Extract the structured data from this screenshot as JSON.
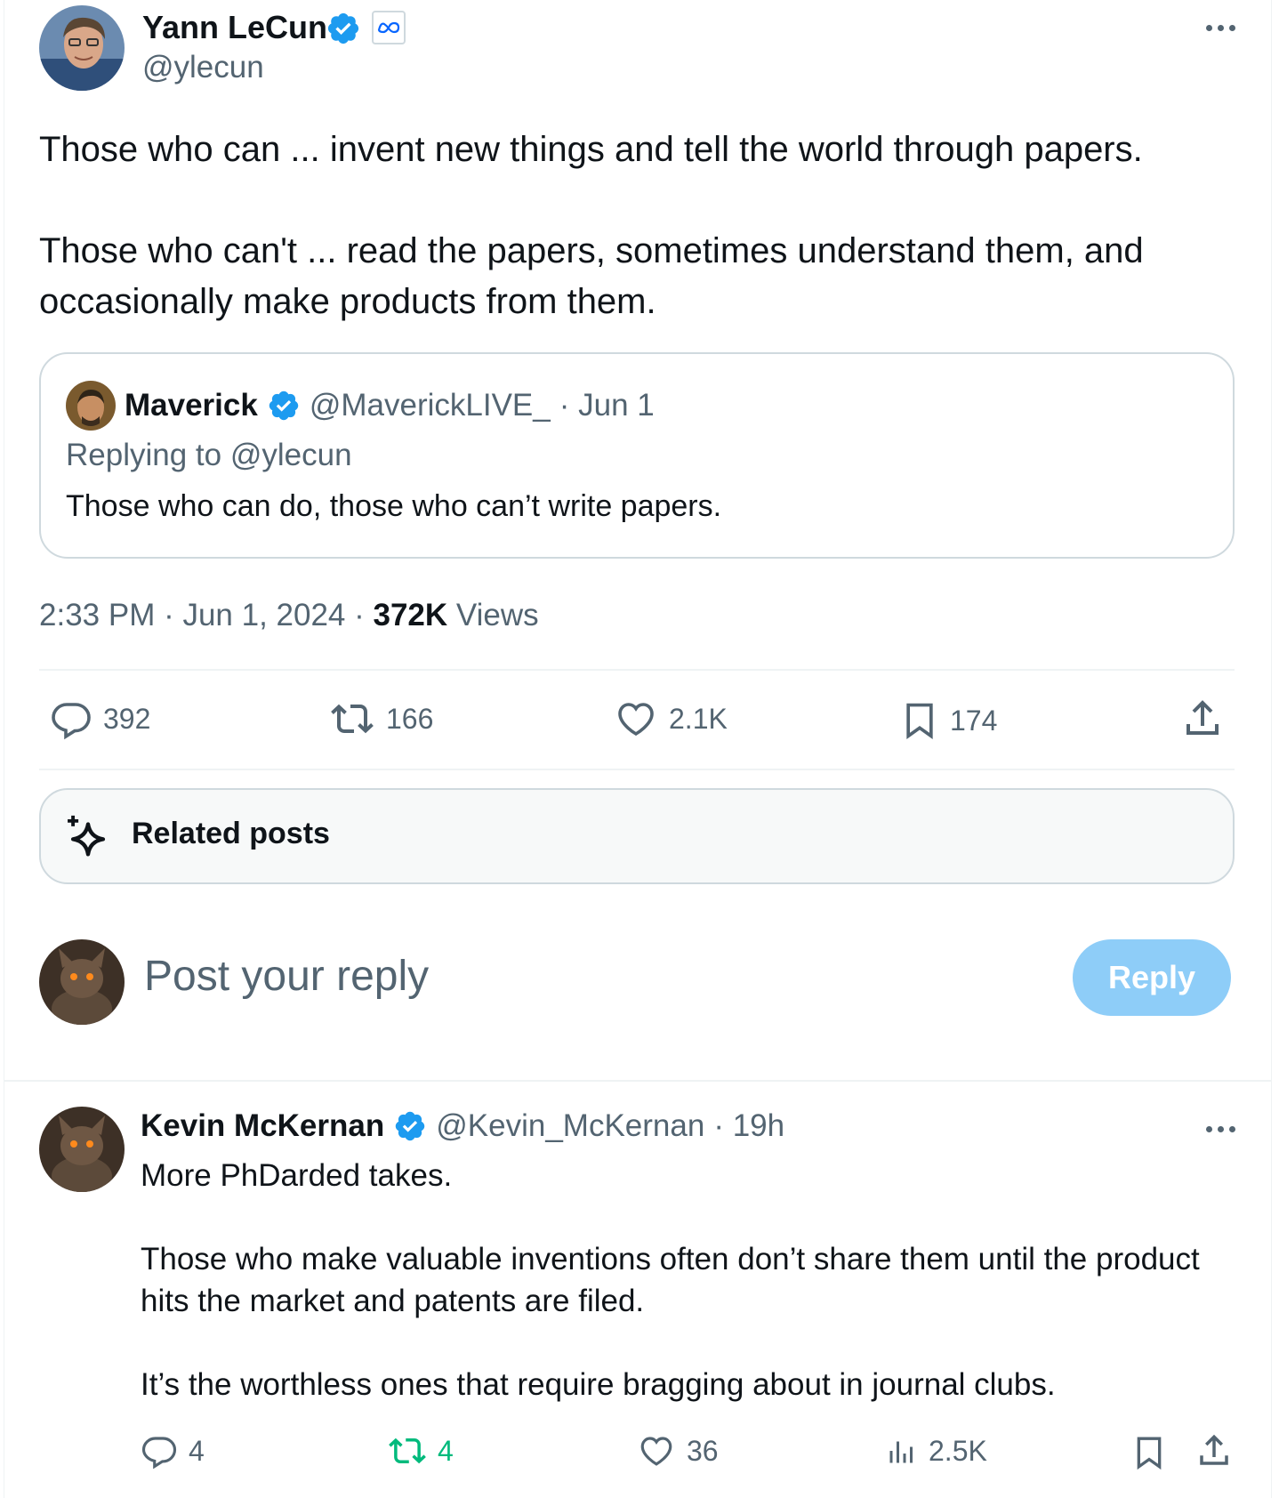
{
  "main_tweet": {
    "author_name": "Yann LeCun",
    "author_handle": "@ylecun",
    "affiliation_badge": "meta-logo",
    "text": "Those who can ... invent new things and tell the world through papers.\n\nThose who can't ... read the papers, sometimes understand them, and occasionally make products from them.",
    "timestamp": "2:33 PM · Jun 1, 2024 · ",
    "views_count": "372K",
    "views_label": " Views",
    "actions": {
      "replies": "392",
      "reposts": "166",
      "likes": "2.1K",
      "bookmarks": "174"
    }
  },
  "quoted_tweet": {
    "author_name": "Maverick",
    "author_handle": "@MaverickLIVE_",
    "date": "· Jun 1",
    "replying_to": "Replying to @ylecun",
    "text": "Those who can do, those who can’t write papers."
  },
  "related_posts": {
    "label": "Related posts"
  },
  "composer": {
    "placeholder": "Post your reply",
    "button_label": "Reply"
  },
  "reply_tweet": {
    "author_name": "Kevin McKernan",
    "author_handle": "@Kevin_McKernan",
    "time": "· 19h",
    "text": "More PhDarded takes.\n\nThose who make valuable inventions often don’t share them until the product hits the market and patents are filed.\n\nIt’s the worthless ones that require bragging about in journal clubs.",
    "actions": {
      "replies": "4",
      "reposts": "4",
      "likes": "36",
      "views": "2.5K"
    }
  },
  "colors": {
    "text_primary": "#0f1419",
    "text_secondary": "#536471",
    "verified_blue": "#1d9bf0",
    "repost_green": "#00ba7c",
    "reply_button_disabled": "#8ecdf8",
    "border": "#cfd9de"
  }
}
